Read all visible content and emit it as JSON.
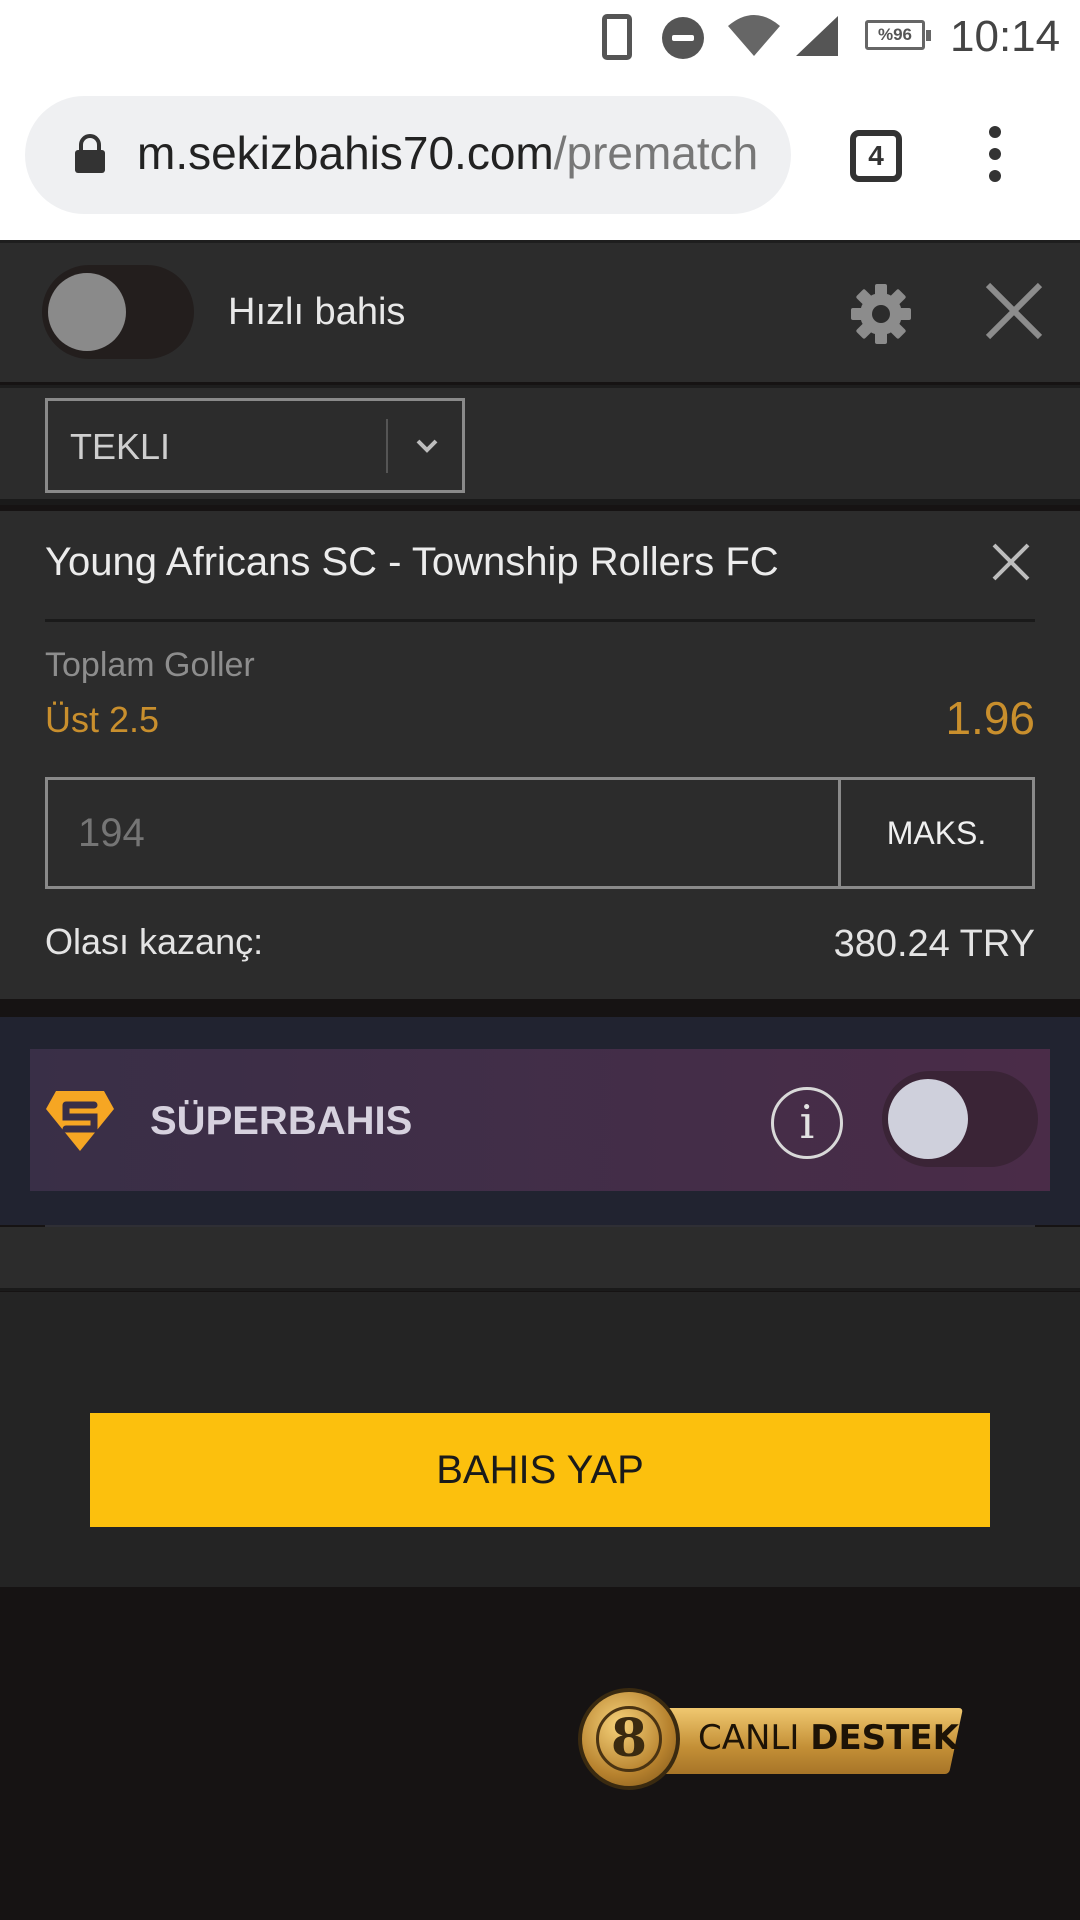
{
  "status_bar": {
    "battery": "%96",
    "time": "10:14"
  },
  "browser": {
    "url_host": "m.sekizbahis70.com",
    "url_path": "/prematch",
    "tab_count": "4"
  },
  "header": {
    "quick_bet_label": "Hızlı bahis",
    "quick_bet_on": false
  },
  "bet_type": {
    "selected": "TEKLI"
  },
  "slip": {
    "match": "Young Africans SC - Township Rollers FC",
    "market": "Toplam Goller",
    "selection": "Üst 2.5",
    "odds": "1.96",
    "stake_placeholder": "194",
    "max_label": "MAKS.",
    "win_label": "Olası kazanç:",
    "win_value": "380.24 TRY"
  },
  "superbahis": {
    "label": "SÜPERBAHIS",
    "enabled": false
  },
  "actions": {
    "place_bet_label": "BAHIS YAP"
  },
  "live_support": {
    "word1": "CANLI",
    "word2": "DESTEK"
  },
  "colors": {
    "accent_yellow": "#fcc00d",
    "odds_orange": "#c98f2d",
    "panel": "#2c2c2c"
  }
}
